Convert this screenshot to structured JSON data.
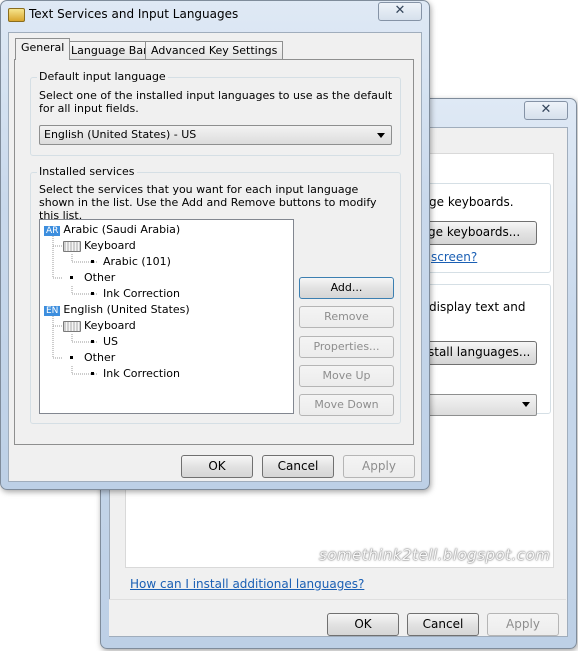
{
  "back_window": {
    "frag_keyboards_text": "ge keyboards.",
    "change_keyboards_button": "ge keyboards...",
    "screen_link": "screen?",
    "display_text_frag": "display text and",
    "install_languages_button": "stall languages...",
    "help_link": "How can I install additional languages?",
    "ok": "OK",
    "cancel": "Cancel",
    "apply": "Apply",
    "close_glyph": "✕"
  },
  "dialog": {
    "title": "Text Services and Input Languages",
    "close_glyph": "✕",
    "tabs": [
      "General",
      "Language Bar",
      "Advanced Key Settings"
    ],
    "default_input": {
      "title": "Default input language",
      "desc": "Select one of the installed input languages to use as the default for all input fields.",
      "selected": "English (United States) - US"
    },
    "installed": {
      "title": "Installed services",
      "desc": "Select the services that you want for each input language shown in the list. Use the Add and Remove buttons to modify this list.",
      "tree": {
        "lang1_badge": "AR",
        "lang1": "Arabic (Saudi Arabia)",
        "lang1_keyboard": "Keyboard",
        "lang1_layout": "Arabic (101)",
        "lang1_other": "Other",
        "lang1_ink": "Ink Correction",
        "lang2_badge": "EN",
        "lang2": "English (United States)",
        "lang2_keyboard": "Keyboard",
        "lang2_layout": "US",
        "lang2_other": "Other",
        "lang2_ink": "Ink Correction"
      },
      "buttons": {
        "add": "Add...",
        "remove": "Remove",
        "properties": "Properties...",
        "move_up": "Move Up",
        "move_down": "Move Down"
      }
    },
    "ok": "OK",
    "cancel": "Cancel",
    "apply": "Apply"
  },
  "watermark": "somethink2tell.blogspot.com"
}
